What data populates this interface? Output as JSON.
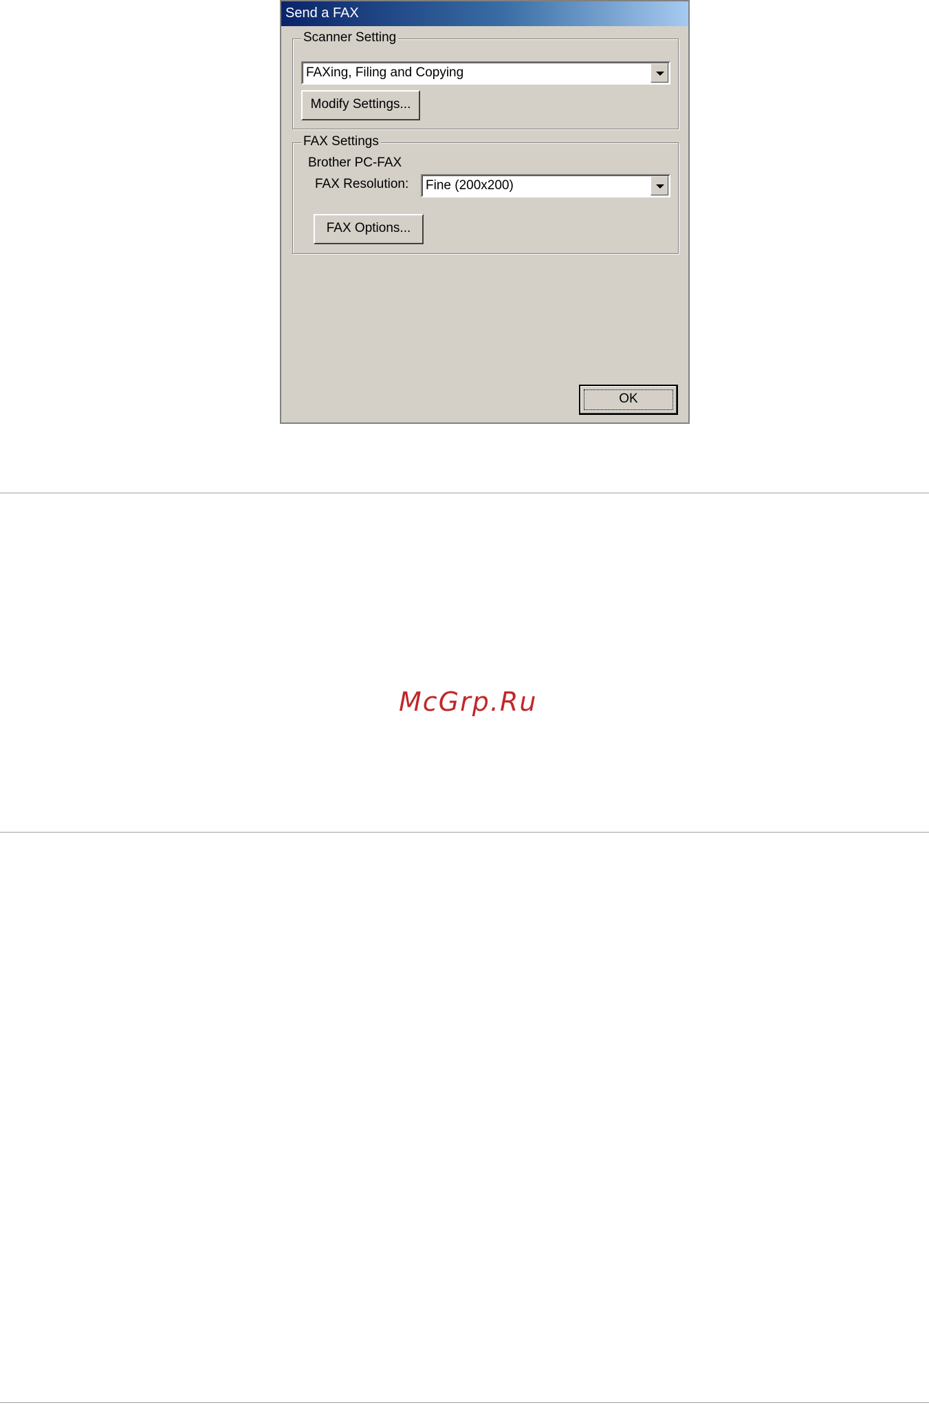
{
  "window": {
    "title": "Send a FAX"
  },
  "scanner_setting": {
    "group_label": "Scanner Setting",
    "profile_value": "FAXing, Filing and Copying",
    "modify_button": "Modify Settings..."
  },
  "fax_settings": {
    "group_label": "FAX Settings",
    "device_name": "Brother PC-FAX",
    "resolution_label": "FAX Resolution:",
    "resolution_value": "Fine (200x200)",
    "options_button": "FAX Options..."
  },
  "ok_button": "OK",
  "watermark": "McGrp.Ru",
  "icons": {
    "dropdown": "chevron-down-icon"
  },
  "colors": {
    "dialog_bg": "#d4d0c8",
    "titlebar": "#0a246a",
    "watermark": "#c0282a"
  }
}
